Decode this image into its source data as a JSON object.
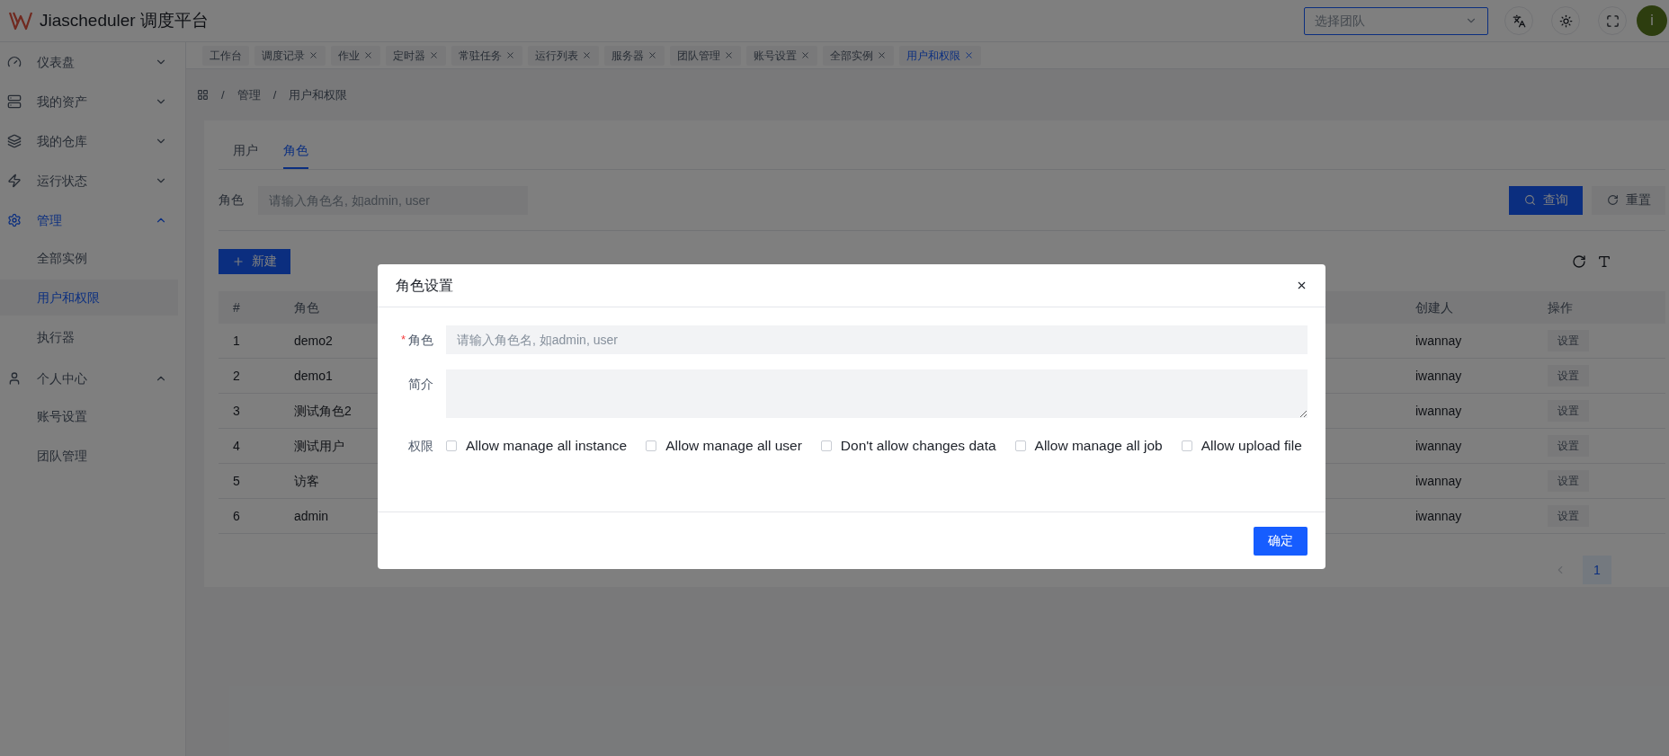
{
  "app": {
    "title": "Jiascheduler 调度平台"
  },
  "header": {
    "team_select": {
      "placeholder": "选择团队"
    },
    "avatar": "i"
  },
  "sidebar": {
    "groups": [
      {
        "label": "仪表盘",
        "active": false,
        "expanded": false
      },
      {
        "label": "我的资产",
        "active": false,
        "expanded": false
      },
      {
        "label": "我的仓库",
        "active": false,
        "expanded": false
      },
      {
        "label": "运行状态",
        "active": false,
        "expanded": false
      },
      {
        "label": "管理",
        "active": true,
        "expanded": true,
        "children": [
          {
            "label": "全部实例",
            "selected": false
          },
          {
            "label": "用户和权限",
            "selected": true
          },
          {
            "label": "执行器",
            "selected": false
          }
        ]
      },
      {
        "label": "个人中心",
        "active": false,
        "expanded": true,
        "children": [
          {
            "label": "账号设置",
            "selected": false
          },
          {
            "label": "团队管理",
            "selected": false
          }
        ]
      }
    ]
  },
  "tabs": [
    {
      "label": "工作台",
      "closable": false,
      "selected": false
    },
    {
      "label": "调度记录",
      "closable": true,
      "selected": false
    },
    {
      "label": "作业",
      "closable": true,
      "selected": false
    },
    {
      "label": "定时器",
      "closable": true,
      "selected": false
    },
    {
      "label": "常驻任务",
      "closable": true,
      "selected": false
    },
    {
      "label": "运行列表",
      "closable": true,
      "selected": false
    },
    {
      "label": "服务器",
      "closable": true,
      "selected": false
    },
    {
      "label": "团队管理",
      "closable": true,
      "selected": false
    },
    {
      "label": "账号设置",
      "closable": true,
      "selected": false
    },
    {
      "label": "全部实例",
      "closable": true,
      "selected": false
    },
    {
      "label": "用户和权限",
      "closable": true,
      "selected": true
    }
  ],
  "breadcrumb": [
    {
      "separator": "/",
      "label": "管理"
    },
    {
      "separator": "/",
      "label": "用户和权限"
    }
  ],
  "page_tabs": [
    {
      "label": "用户",
      "selected": false
    },
    {
      "label": "角色",
      "selected": true
    }
  ],
  "filter": {
    "label": "角色",
    "placeholder": "请输入角色名, 如admin, user",
    "search_button": "查询",
    "reset_button": "重置"
  },
  "new_button": "新建",
  "table": {
    "columns": [
      "#",
      "角色",
      "创建人",
      "操作"
    ],
    "rows": [
      {
        "cells": [
          "1",
          "demo2",
          "iwannay"
        ],
        "action": "设置"
      },
      {
        "cells": [
          "2",
          "demo1",
          "iwannay"
        ],
        "action": "设置"
      },
      {
        "cells": [
          "3",
          "测试角色2",
          "iwannay"
        ],
        "action": "设置"
      },
      {
        "cells": [
          "4",
          "测试用户",
          "iwannay"
        ],
        "action": "设置"
      },
      {
        "cells": [
          "5",
          "访客",
          "iwannay"
        ],
        "action": "设置"
      },
      {
        "cells": [
          "6",
          "admin",
          "iwannay"
        ],
        "action": "设置"
      }
    ]
  },
  "pagination": {
    "pages": [
      {
        "label": "1",
        "selected": true
      }
    ]
  },
  "modal": {
    "title": "角色设置",
    "fields": [
      {
        "kind": "input",
        "label": "角色",
        "required_mark": "*",
        "placeholder": "请输入角色名, 如admin, user"
      },
      {
        "kind": "textarea",
        "label": "简介"
      }
    ],
    "permissions": {
      "label": "权限",
      "options": [
        {
          "label": "Allow manage all instance",
          "checked": false
        },
        {
          "label": "Allow manage all user",
          "checked": false
        },
        {
          "label": "Don't allow changes data",
          "checked": false
        },
        {
          "label": "Allow manage all job",
          "checked": false
        },
        {
          "label": "Allow upload file",
          "checked": false
        }
      ]
    },
    "confirm_button": "确定"
  }
}
